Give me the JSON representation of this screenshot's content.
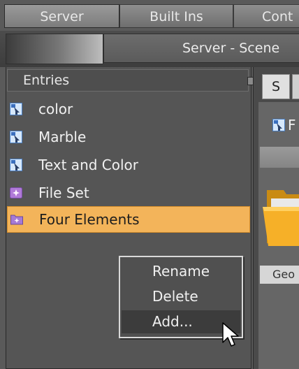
{
  "top_tabs": [
    {
      "label": "Server",
      "active": true
    },
    {
      "label": "Built Ins",
      "active": false
    },
    {
      "label": "Cont",
      "active": false
    }
  ],
  "window_title": "Server - Scene",
  "entries_panel": {
    "header": "Entries",
    "items": [
      {
        "label": "color",
        "icon": "scene-icon",
        "selected": false
      },
      {
        "label": "Marble",
        "icon": "scene-icon",
        "selected": false
      },
      {
        "label": "Text and Color",
        "icon": "scene-icon",
        "selected": false
      },
      {
        "label": "File Set",
        "icon": "file-set-icon",
        "selected": false
      },
      {
        "label": "Four Elements",
        "icon": "folder-set-icon",
        "selected": true
      }
    ]
  },
  "context_menu": {
    "items": [
      "Rename",
      "Delete",
      "Add..."
    ],
    "hovered": "Add..."
  },
  "right_panel": {
    "tabs": [
      "S",
      ""
    ],
    "file_label": "F",
    "item_label": "Geo"
  },
  "colors": {
    "selection": "#f3b45a",
    "panel_bg": "#555555",
    "menu_border": "#d9d9d9"
  }
}
